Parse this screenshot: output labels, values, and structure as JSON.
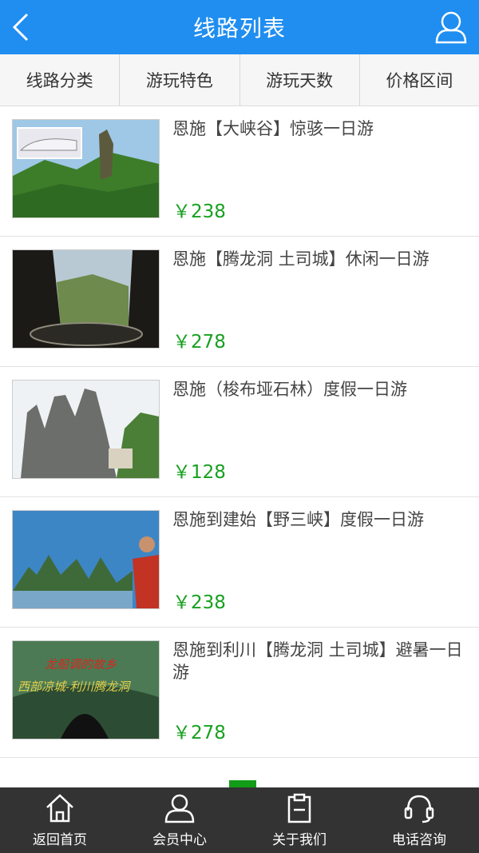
{
  "header": {
    "title": "线路列表"
  },
  "filters": [
    "线路分类",
    "游玩特色",
    "游玩天数",
    "价格区间"
  ],
  "routes": [
    {
      "name": "恩施【大峡谷】惊骇一日游",
      "price": "￥238"
    },
    {
      "name": "恩施【腾龙洞 土司城】休闲一日游",
      "price": "￥278"
    },
    {
      "name": "恩施（梭布垭石林）度假一日游",
      "price": "￥128"
    },
    {
      "name": "恩施到建始【野三峡】度假一日游",
      "price": "￥238"
    },
    {
      "name": "恩施到利川【腾龙洞 土司城】避暑一日游",
      "price": "￥278"
    }
  ],
  "thumb_text": {
    "img5_line1": "龙船调的故乡",
    "img5_line2": "西部凉城-利川腾龙洞"
  },
  "tabbar": [
    {
      "label": "返回首页",
      "icon": "home-icon"
    },
    {
      "label": "会员中心",
      "icon": "user-icon"
    },
    {
      "label": "关于我们",
      "icon": "clipboard-icon"
    },
    {
      "label": "电话咨询",
      "icon": "headset-icon"
    }
  ],
  "colors": {
    "header": "#1f8ef0",
    "price": "#17a01f",
    "tabbar": "#333333",
    "pager": "#129c18"
  }
}
